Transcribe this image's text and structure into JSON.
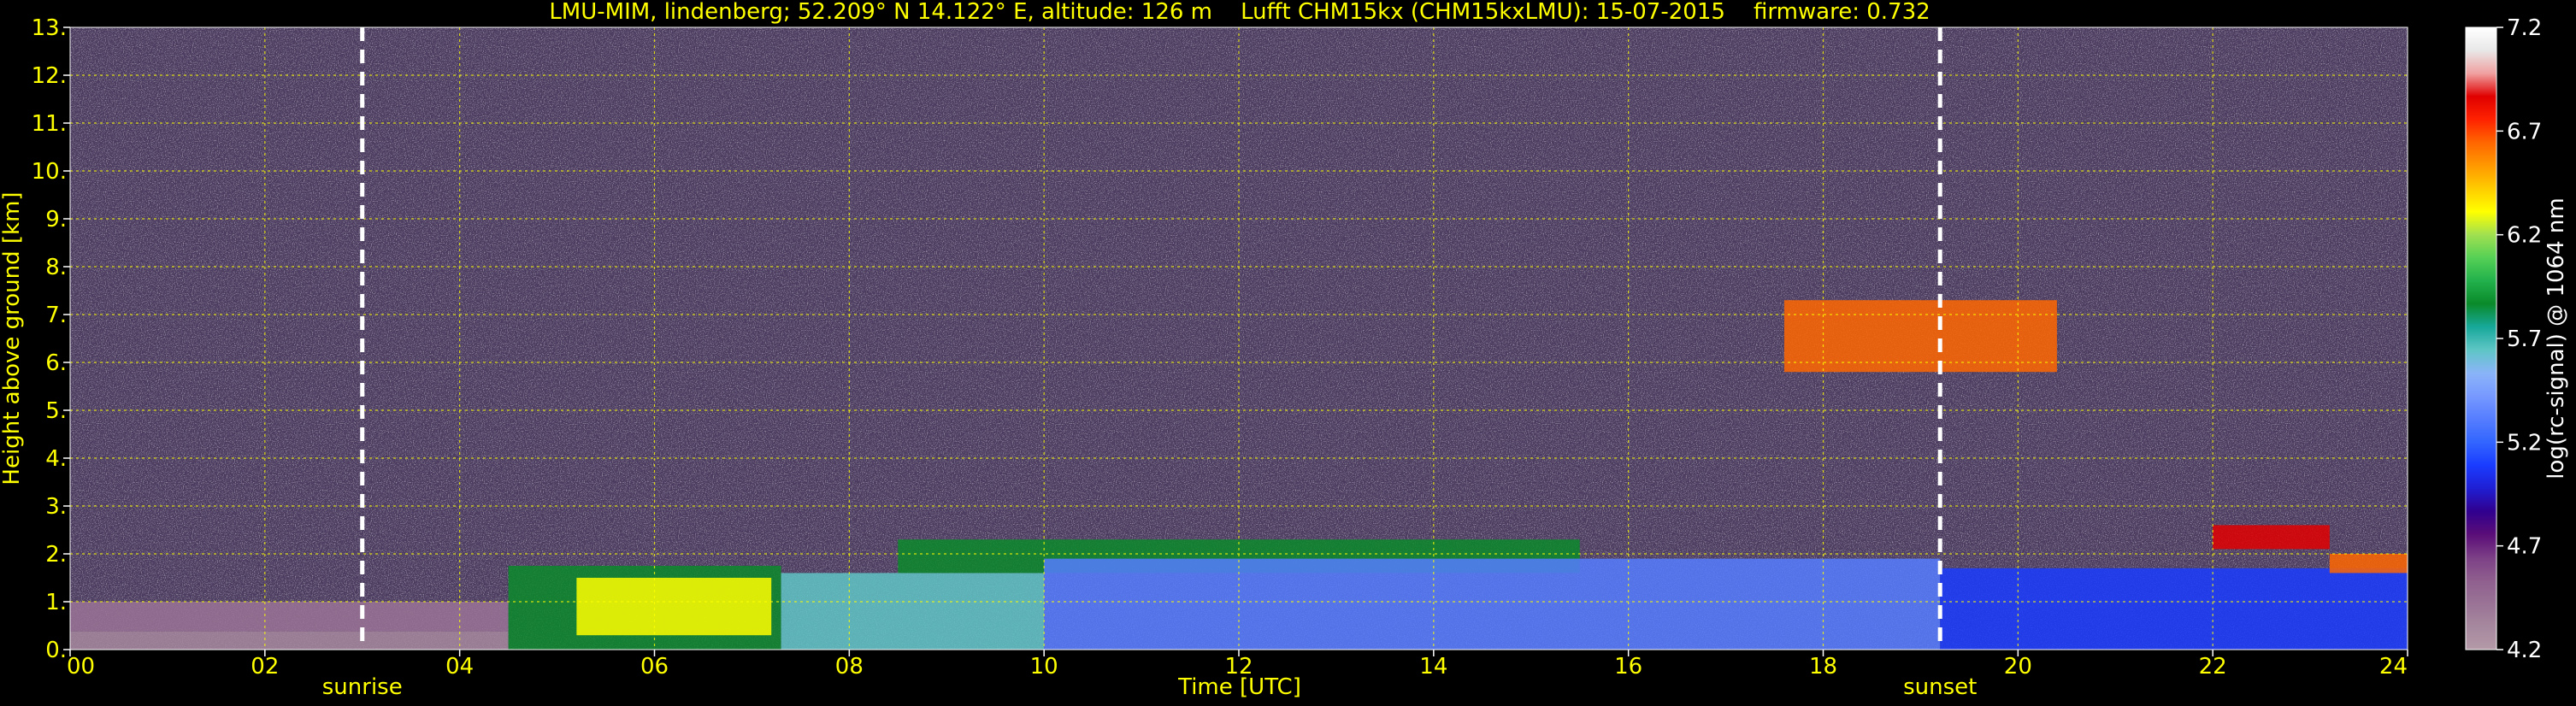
{
  "chart_data": {
    "type": "heatmap",
    "title": "LMU-MIM, lindenberg; 52.209° N 14.122° E, altitude: 126 m    Lufft CHM15kx (CHM15kxLMU): 15-07-2015    firmware: 0.732",
    "xlabel": "Time [UTC]",
    "ylabel": "Height above ground [km]",
    "xlim": [
      0,
      24
    ],
    "ylim": [
      0,
      13
    ],
    "x_ticks": [
      "00",
      "02",
      "04",
      "06",
      "08",
      "10",
      "12",
      "14",
      "16",
      "18",
      "20",
      "22",
      "24"
    ],
    "x_tick_values": [
      0,
      2,
      4,
      6,
      8,
      10,
      12,
      14,
      16,
      18,
      20,
      22,
      24
    ],
    "y_ticks": [
      "0.",
      "1.",
      "2.",
      "3.",
      "4.",
      "5.",
      "6.",
      "7.",
      "8.",
      "9.",
      "10.",
      "11.",
      "12.",
      "13."
    ],
    "y_tick_values": [
      0,
      1,
      2,
      3,
      4,
      5,
      6,
      7,
      8,
      9,
      10,
      11,
      12,
      13
    ],
    "grid": true,
    "colorbar": {
      "label": "log(rc-signal) @ 1064 nm",
      "range": [
        4.2,
        7.2
      ],
      "ticks": [
        "4.2",
        "4.7",
        "5.2",
        "5.7",
        "6.2",
        "6.7",
        "7.2"
      ],
      "tick_values": [
        4.2,
        4.7,
        5.2,
        5.7,
        6.2,
        6.7,
        7.2
      ],
      "colors": [
        "#b49aa8",
        "#a6889e",
        "#9a7396",
        "#8f5f8e",
        "#7c3f86",
        "#5a0d78",
        "#30008e",
        "#1f1fd4",
        "#1a3cff",
        "#3366ff",
        "#557dff",
        "#7799ff",
        "#8ab4f8",
        "#5fc6c6",
        "#17a89a",
        "#0a8a2a",
        "#22b14c",
        "#55d055",
        "#a0e050",
        "#ffff00",
        "#ffcc00",
        "#ff9900",
        "#ff6600",
        "#ff2200",
        "#e00000",
        "#f0a0a0",
        "#e8e8e8",
        "#ffffff"
      ]
    },
    "events": [
      {
        "label": "sunrise",
        "time": 3.0
      },
      {
        "label": "sunset",
        "time": 19.2
      }
    ],
    "layers": [
      {
        "t0": 0.0,
        "t1": 4.5,
        "h0": 0.0,
        "h1": 0.38,
        "value": 4.3
      },
      {
        "t0": 0.0,
        "t1": 4.5,
        "h0": 0.38,
        "h1": 1.0,
        "value": 4.4
      },
      {
        "t0": 4.5,
        "t1": 7.3,
        "h0": 0.0,
        "h1": 1.75,
        "value": 5.9
      },
      {
        "t0": 5.2,
        "t1": 7.2,
        "h0": 0.3,
        "h1": 1.5,
        "value": 6.3
      },
      {
        "t0": 7.3,
        "t1": 10.0,
        "h0": 0.0,
        "h1": 1.6,
        "value": 5.6
      },
      {
        "t0": 8.5,
        "t1": 15.5,
        "h0": 1.6,
        "h1": 2.3,
        "value": 5.9
      },
      {
        "t0": 10.0,
        "t1": 19.2,
        "h0": 0.0,
        "h1": 1.9,
        "value": 5.35
      },
      {
        "t0": 19.2,
        "t1": 24.0,
        "h0": 0.0,
        "h1": 1.7,
        "value": 5.1
      },
      {
        "t0": 17.6,
        "t1": 20.4,
        "h0": 5.8,
        "h1": 7.3,
        "value": 6.6
      },
      {
        "t0": 22.0,
        "t1": 23.2,
        "h0": 2.1,
        "h1": 2.6,
        "value": 6.9
      },
      {
        "t0": 23.2,
        "t1": 24.0,
        "h0": 1.6,
        "h1": 2.0,
        "value": 6.6
      }
    ]
  }
}
